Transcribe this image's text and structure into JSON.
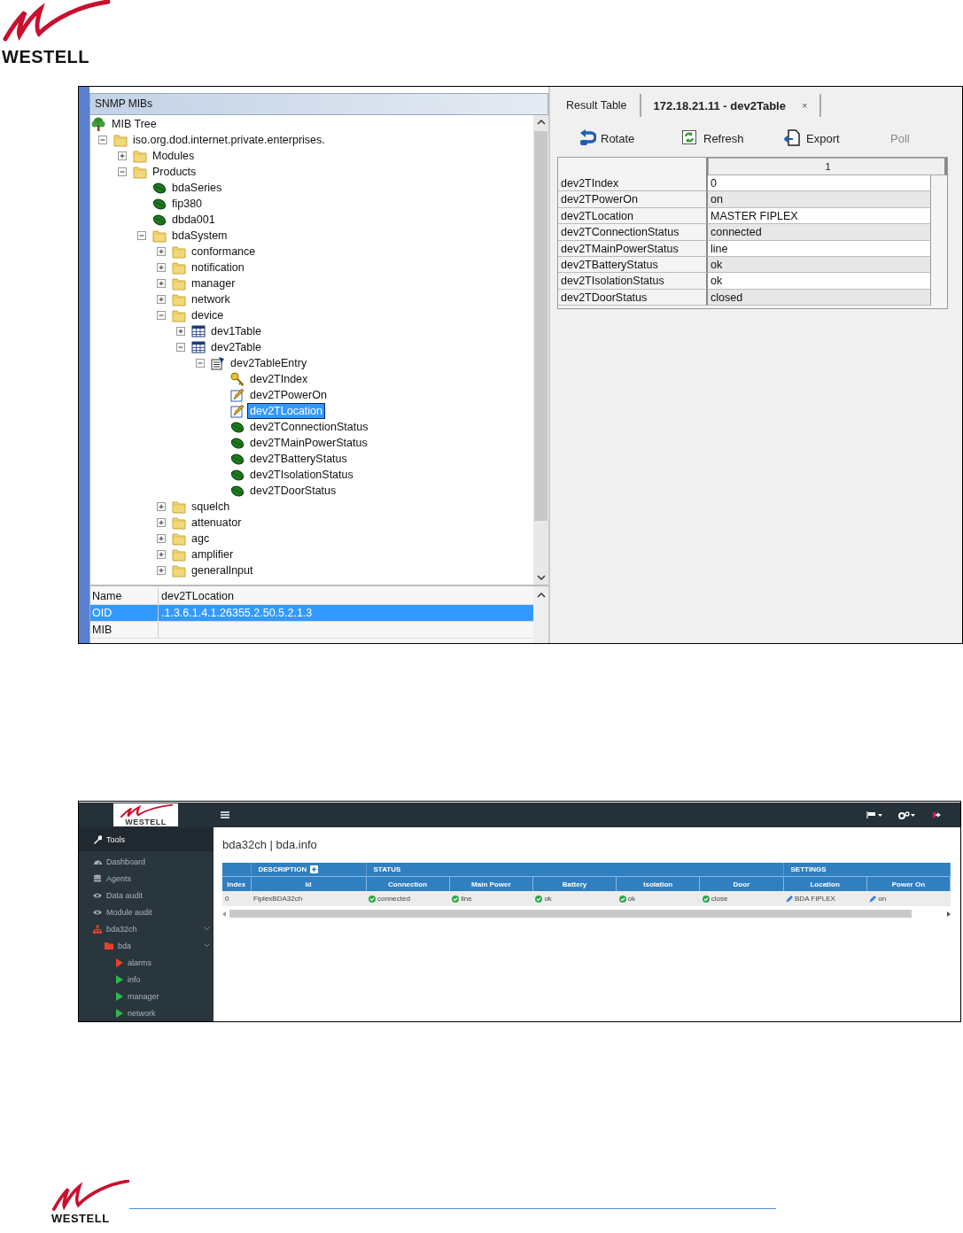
{
  "top_logo": {
    "wordmark": "WESTELL"
  },
  "mib_browser": {
    "panel_title": "SNMP MIBs",
    "tree_root": "MIB Tree",
    "tree": [
      {
        "label": "iso.org.dod.internet.private.enterprises.",
        "kind": "folder",
        "expanded": true,
        "selected": false,
        "children": [
          {
            "label": "Modules",
            "kind": "folder",
            "expanded": false,
            "selected": false
          },
          {
            "label": "Products",
            "kind": "folder",
            "expanded": true,
            "selected": false,
            "children": [
              {
                "label": "bdaSeries",
                "kind": "leaf",
                "selected": false
              },
              {
                "label": "fip380",
                "kind": "leaf",
                "selected": false
              },
              {
                "label": "dbda001",
                "kind": "leaf",
                "selected": false
              },
              {
                "label": "bdaSystem",
                "kind": "folder",
                "expanded": true,
                "selected": false,
                "children": [
                  {
                    "label": "conformance",
                    "kind": "folder",
                    "expanded": false,
                    "selected": false
                  },
                  {
                    "label": "notification",
                    "kind": "folder",
                    "expanded": false,
                    "selected": false
                  },
                  {
                    "label": "manager",
                    "kind": "folder",
                    "expanded": false,
                    "selected": false
                  },
                  {
                    "label": "network",
                    "kind": "folder",
                    "expanded": false,
                    "selected": false
                  },
                  {
                    "label": "device",
                    "kind": "folder",
                    "expanded": true,
                    "selected": false,
                    "children": [
                      {
                        "label": "dev1Table",
                        "kind": "table",
                        "expanded": false,
                        "selected": false
                      },
                      {
                        "label": "dev2Table",
                        "kind": "table",
                        "expanded": true,
                        "selected": false,
                        "children": [
                          {
                            "label": "dev2TableEntry",
                            "kind": "entry",
                            "expanded": true,
                            "selected": false,
                            "children": [
                              {
                                "label": "dev2TIndex",
                                "kind": "key",
                                "selected": false
                              },
                              {
                                "label": "dev2TPowerOn",
                                "kind": "writable",
                                "selected": false
                              },
                              {
                                "label": "dev2TLocation",
                                "kind": "writable",
                                "selected": true
                              },
                              {
                                "label": "dev2TConnectionStatus",
                                "kind": "leaf",
                                "selected": false
                              },
                              {
                                "label": "dev2TMainPowerStatus",
                                "kind": "leaf",
                                "selected": false
                              },
                              {
                                "label": "dev2TBatteryStatus",
                                "kind": "leaf",
                                "selected": false
                              },
                              {
                                "label": "dev2TIsolationStatus",
                                "kind": "leaf",
                                "selected": false
                              },
                              {
                                "label": "dev2TDoorStatus",
                                "kind": "leaf",
                                "selected": false
                              }
                            ]
                          }
                        ]
                      }
                    ]
                  },
                  {
                    "label": "squelch",
                    "kind": "folder",
                    "expanded": false,
                    "selected": false
                  },
                  {
                    "label": "attenuator",
                    "kind": "folder",
                    "expanded": false,
                    "selected": false
                  },
                  {
                    "label": "agc",
                    "kind": "folder",
                    "expanded": false,
                    "selected": false
                  },
                  {
                    "label": "amplifier",
                    "kind": "folder",
                    "expanded": false,
                    "selected": false
                  },
                  {
                    "label": "generalInput",
                    "kind": "folder",
                    "expanded": false,
                    "selected": false
                  }
                ]
              }
            ]
          }
        ]
      }
    ],
    "properties": [
      {
        "name": "Name",
        "value": "dev2TLocation",
        "selected": false
      },
      {
        "name": "OID",
        "value": ".1.3.6.1.4.1.26355.2.50.5.2.1.3",
        "selected": true
      },
      {
        "name": "MIB",
        "selected": false
      }
    ]
  },
  "result_view": {
    "tabs": [
      {
        "label": "Result Table",
        "selected": false
      },
      {
        "label": "172.18.21.11 - dev2Table",
        "selected": true,
        "close_glyph": "×"
      }
    ],
    "toolbar": [
      {
        "label": "Rotate",
        "kind": "rotate",
        "disabled": false
      },
      {
        "label": "Refresh",
        "kind": "refresh",
        "disabled": false
      },
      {
        "label": "Export",
        "kind": "export",
        "disabled": false
      },
      {
        "label": "Poll",
        "kind": "poll",
        "disabled": true
      }
    ],
    "table": {
      "columns": [
        "1"
      ],
      "rows": [
        {
          "name": "dev2TIndex",
          "value": "0"
        },
        {
          "name": "dev2TPowerOn",
          "value": "on"
        },
        {
          "name": "dev2TLocation",
          "value": "MASTER FIPLEX"
        },
        {
          "name": "dev2TConnectionStatus",
          "value": "connected"
        },
        {
          "name": "dev2TMainPowerStatus",
          "value": "line"
        },
        {
          "name": "dev2TBatteryStatus",
          "value": "ok"
        },
        {
          "name": "dev2TIsolationStatus",
          "value": "ok"
        },
        {
          "name": "dev2TDoorStatus",
          "value": "closed"
        }
      ]
    }
  },
  "web_console": {
    "logo_wordmark": "WESTELL",
    "sidebar": [
      {
        "label": "Tools",
        "kind": "section"
      },
      {
        "label": "Dashboard",
        "kind": "dashboard"
      },
      {
        "label": "Agents",
        "kind": "agents"
      },
      {
        "label": "Data audit",
        "kind": "audit"
      },
      {
        "label": "Module audit",
        "kind": "audit"
      },
      {
        "label": "bda32ch",
        "kind": "group",
        "expanded": true,
        "children": [
          {
            "label": "bda",
            "kind": "folder",
            "expanded": true,
            "children": [
              {
                "label": "alarms",
                "kind": "page",
                "color": "#e8402a"
              },
              {
                "label": "info",
                "kind": "page",
                "color": "#2fb84a"
              },
              {
                "label": "manager",
                "kind": "page",
                "color": "#2fb84a"
              },
              {
                "label": "network",
                "kind": "page",
                "color": "#2fb84a"
              }
            ]
          }
        ]
      }
    ],
    "page_title": "bda32ch | bda.info",
    "table": {
      "groups": [
        {
          "columns": [
            "Index"
          ]
        },
        {
          "label": "DESCRIPTION",
          "expandable": true,
          "columns": [
            "Id"
          ]
        },
        {
          "label": "STATUS",
          "columns": [
            "Connection",
            "Main Power",
            "Battery",
            "Isolation",
            "Door"
          ]
        },
        {
          "label": "SETTINGS",
          "columns": [
            "Location",
            "Power On"
          ]
        }
      ],
      "rows": [
        {
          "cells": [
            {
              "text": "0",
              "kind": "plain"
            },
            {
              "text": "FiplexBDA32ch",
              "kind": "plain"
            },
            {
              "text": "connected",
              "kind": "status"
            },
            {
              "text": "line",
              "kind": "status"
            },
            {
              "text": "ok",
              "kind": "status"
            },
            {
              "text": "ok",
              "kind": "status"
            },
            {
              "text": "close",
              "kind": "status"
            },
            {
              "text": "BDA FIPLEX",
              "kind": "editable"
            },
            {
              "text": "on",
              "kind": "editable"
            }
          ]
        }
      ]
    }
  },
  "footer": {
    "wordmark": "WESTELL"
  }
}
